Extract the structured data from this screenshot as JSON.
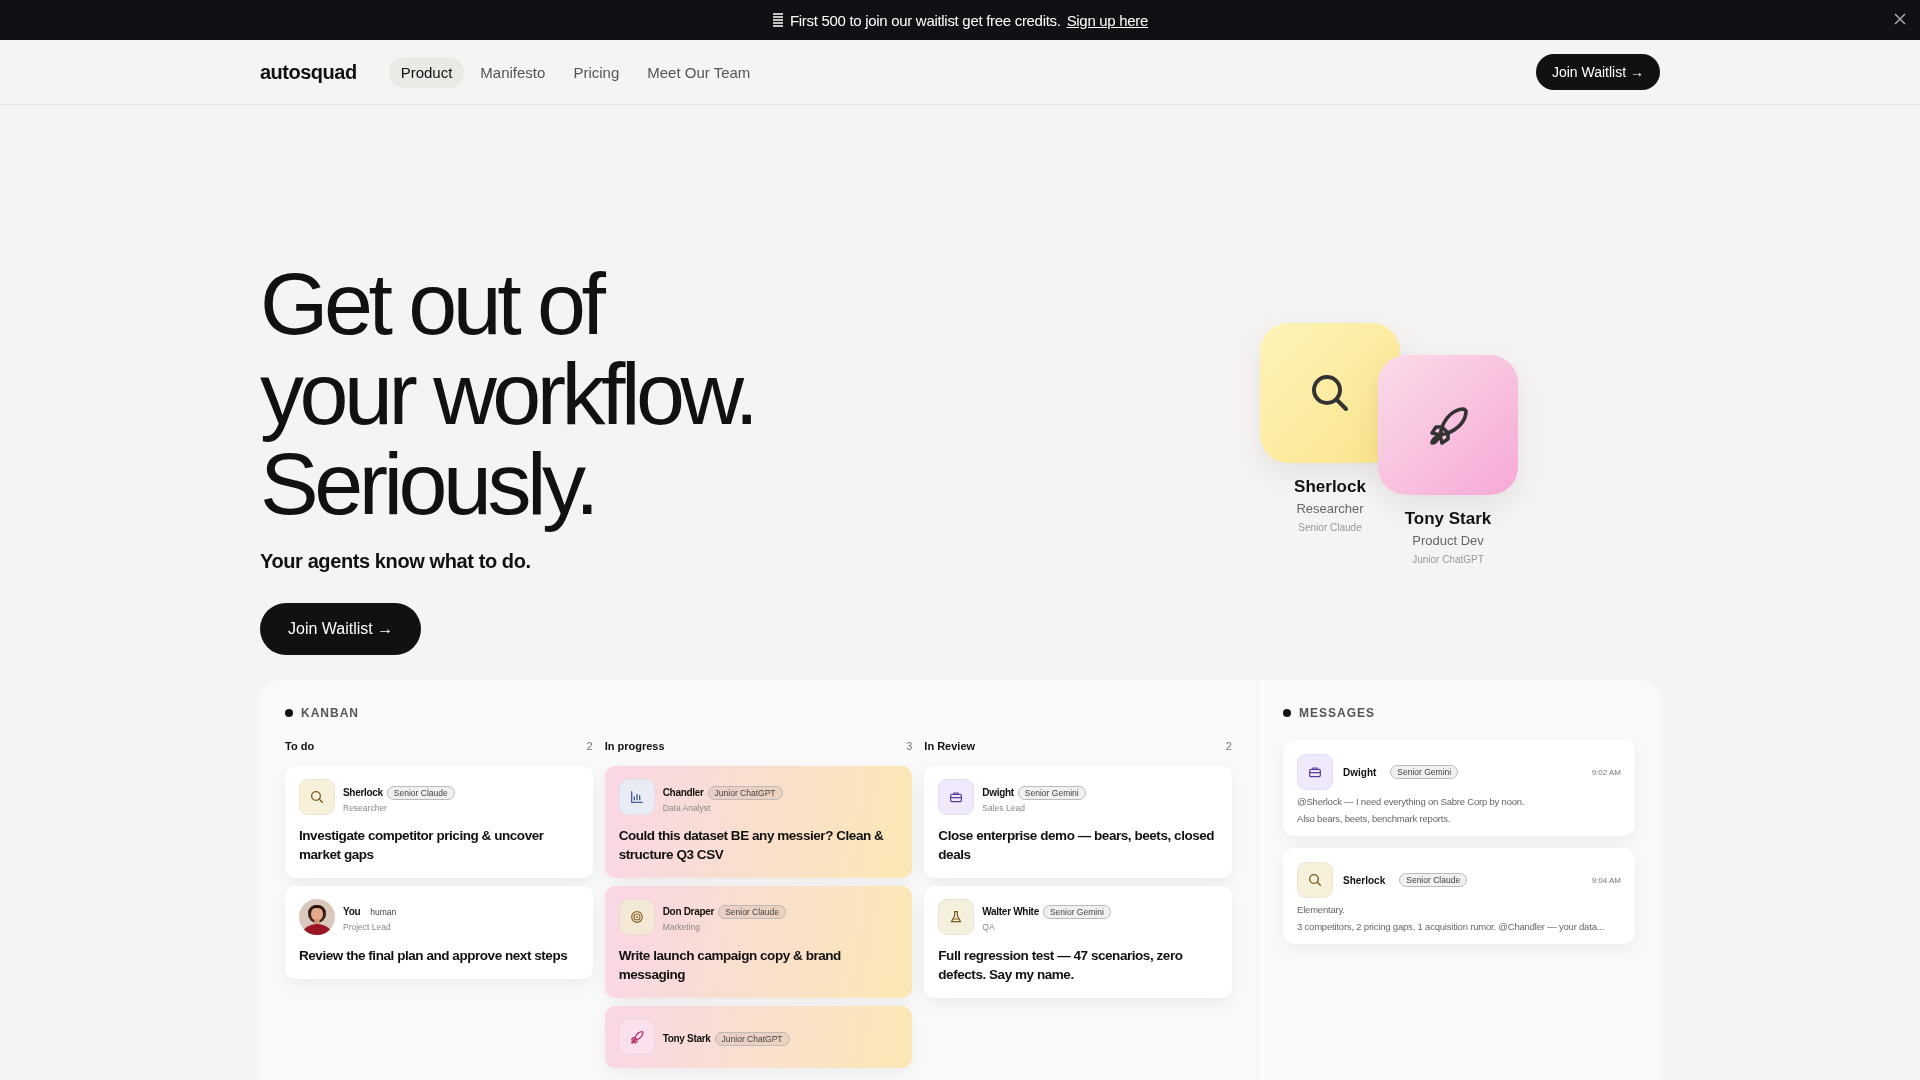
{
  "banner": {
    "text": "First 500 to join our waitlist get free credits.",
    "link": "Sign up here"
  },
  "nav": {
    "logo": "autosquad",
    "items": [
      {
        "label": "Product",
        "selected": true
      },
      {
        "label": "Manifesto",
        "selected": false
      },
      {
        "label": "Pricing",
        "selected": false
      },
      {
        "label": "Meet Our Team",
        "selected": false
      }
    ],
    "cta": "Join Waitlist →"
  },
  "hero": {
    "title_lines": [
      "Get out of",
      "your workflow.",
      "Seriously."
    ],
    "subtitle": "Your agents know what to do.",
    "cta": "Join Waitlist →"
  },
  "agents": [
    {
      "kind": "search",
      "name": "Sherlock",
      "role": "Researcher",
      "model": "Senior Claude"
    },
    {
      "kind": "rocket",
      "name": "Tony Stark",
      "role": "Product Dev",
      "model": "Junior ChatGPT"
    }
  ],
  "kanban": {
    "title": "KANBAN",
    "columns": [
      {
        "name": "To do",
        "count": "2",
        "kind": "plain",
        "cards": [
          {
            "kind": "search",
            "name": "Sherlock",
            "badge": "Senior Claude",
            "role": "Researcher",
            "task": "Investigate competitor pricing & uncover market gaps"
          },
          {
            "kind": "person",
            "name": "You",
            "badge": "human",
            "role": "Project Lead",
            "task": "Review the final plan and approve next steps"
          }
        ]
      },
      {
        "name": "In progress",
        "count": "3",
        "kind": "gradient",
        "cards": [
          {
            "kind": "chart",
            "name": "Chandler",
            "badge": "Junior ChatGPT",
            "role": "Data Analyst",
            "task": "Could this dataset BE any messier? Clean & structure Q3 CSV"
          },
          {
            "kind": "target",
            "name": "Don Draper",
            "badge": "Senior Claude",
            "role": "Marketing",
            "task": "Write launch campaign copy & brand messaging"
          },
          {
            "kind": "rocket",
            "name": "Tony Stark",
            "badge": "Junior ChatGPT"
          }
        ]
      },
      {
        "name": "In Review",
        "count": "2",
        "kind": "plain",
        "cards": [
          {
            "kind": "briefcase",
            "name": "Dwight",
            "badge": "Senior Gemini",
            "role": "Sales Lead",
            "task": "Close enterprise demo — bears, beets, closed deals"
          },
          {
            "kind": "flask",
            "name": "Walter White",
            "badge": "Senior Gemini",
            "role": "QA",
            "task": "Full regression test — 47 scenarios, zero defects. Say my name."
          }
        ]
      }
    ]
  },
  "messages": {
    "title": "MESSAGES",
    "items": [
      {
        "kind": "briefcase",
        "name": "Dwight",
        "badge": "Senior Gemini",
        "time": "9:02 AM",
        "lines": [
          "@Sherlock — I need everything on Sabre Corp by noon.",
          "Also bears, beets, benchmark reports."
        ]
      },
      {
        "kind": "search",
        "name": "Sherlock",
        "badge": "Senior Claude",
        "time": "9:04 AM",
        "lines": [
          "Elementary.",
          "3 competitors, 2 pricing gaps, 1 acquisition rumor. @Chandler — your data..."
        ]
      }
    ]
  }
}
